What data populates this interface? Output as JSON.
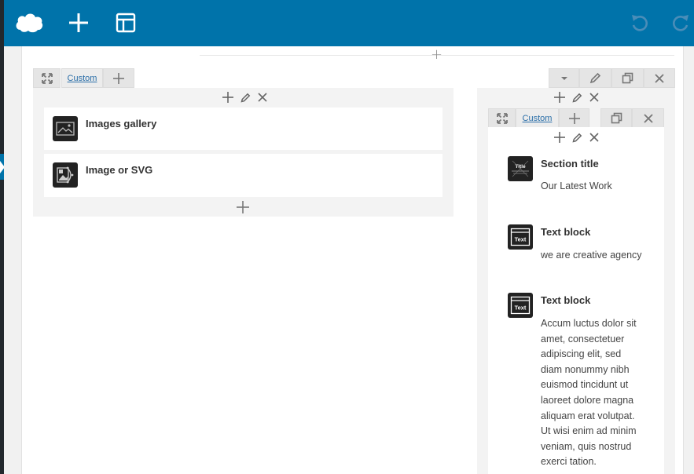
{
  "toolbar": {
    "logo_icon": "cloud-logo-icon",
    "add_icon": "plus-icon",
    "layout_icon": "layout-icon",
    "undo_icon": "undo-icon",
    "redo_icon": "redo-icon"
  },
  "left_column": {
    "tab_label": "Custom",
    "elements": [
      {
        "title": "Images gallery",
        "icon": "images-gallery-icon"
      },
      {
        "title": "Image or SVG",
        "icon": "image-svg-icon"
      }
    ]
  },
  "right_column": {
    "inner_tab_label": "Custom",
    "elements": [
      {
        "title": "Section title",
        "icon": "section-title-icon",
        "icon_text": "Title",
        "text": "Our Latest Work"
      },
      {
        "title": "Text block",
        "icon": "text-block-icon",
        "icon_text": "Text",
        "text": "we are creative agency"
      },
      {
        "title": "Text block",
        "icon": "text-block-icon",
        "icon_text": "Text",
        "text_lines": [
          "Accum luctus dolor sit",
          "amet, consectetuer",
          "adipiscing elit, sed",
          "diam nonummy nibh",
          "euismod tincidunt ut",
          "laoreet dolore magna",
          "aliquam erat volutpat.",
          "Ut wisi enim ad minim",
          "veniam, quis nostrud",
          "exerci tation."
        ]
      }
    ]
  },
  "colors": {
    "toolbar_bg": "#0073aa",
    "link": "#2a6ea8"
  }
}
